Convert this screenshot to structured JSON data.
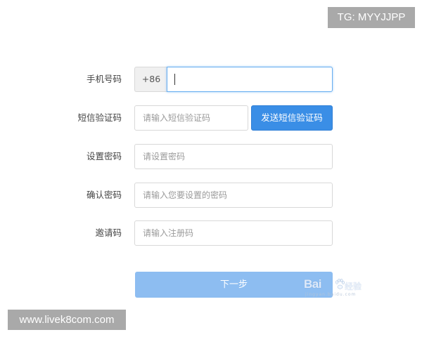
{
  "overlay": {
    "top_tag": "TG: MYYJJPP",
    "bottom_tag": "www.livek8com.com"
  },
  "form": {
    "phone": {
      "label": "手机号码",
      "prefix": "+86",
      "value": "",
      "placeholder": ""
    },
    "sms_code": {
      "label": "短信验证码",
      "placeholder": "请输入短信验证码",
      "send_button": "发送短信验证码"
    },
    "password": {
      "label": "设置密码",
      "placeholder": "请设置密码"
    },
    "confirm_password": {
      "label": "确认密码",
      "placeholder": "请输入您要设置的密码"
    },
    "invite_code": {
      "label": "邀请码",
      "placeholder": "请输入注册码"
    },
    "next_button": "下一步"
  },
  "watermark": {
    "brand": "Bai",
    "side": "经验",
    "sub": "jingyan.baidu.com",
    "paw_icon": "baidu-paw-icon"
  },
  "colors": {
    "primary_button": "#3a8ee6",
    "next_button": "#8dbdf1",
    "focus_border": "#67aef0",
    "overlay_tag": "#a9a9a9"
  }
}
